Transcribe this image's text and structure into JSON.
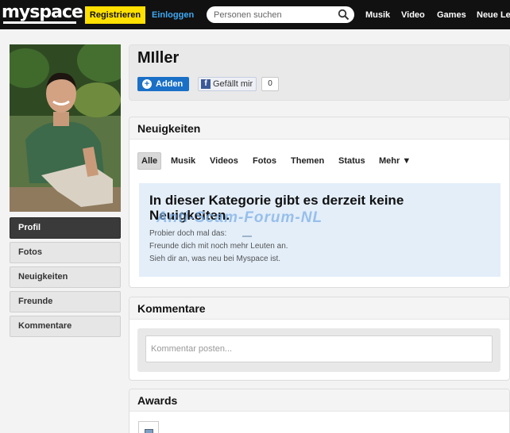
{
  "topbar": {
    "logo": "myspace",
    "register_label": "Registrieren",
    "login_label": "Einloggen",
    "search_placeholder": "Personen suchen",
    "nav": [
      "Musik",
      "Video",
      "Games",
      "Neue Le"
    ]
  },
  "sidebar": {
    "items": [
      {
        "label": "Profil",
        "active": true
      },
      {
        "label": "Fotos"
      },
      {
        "label": "Neuigkeiten"
      },
      {
        "label": "Freunde"
      },
      {
        "label": "Kommentare"
      }
    ]
  },
  "profile": {
    "name": "MIller",
    "add_label": "Adden",
    "like_label": "Gefällt mir",
    "like_count": "0"
  },
  "news": {
    "title": "Neuigkeiten",
    "filters": [
      "Alle",
      "Musik",
      "Videos",
      "Fotos",
      "Themen",
      "Status",
      "Mehr ▼"
    ],
    "empty_title": "In dieser Kategorie gibt es derzeit keine Neuigkeiten.",
    "watermark": "Anti-Scam-Forum-NL",
    "hint_heading": "Probier doch mal das:",
    "hint_1": "Freunde dich mit noch mehr Leuten an.",
    "hint_2": "Sieh dir an, was neu bei Myspace ist."
  },
  "comments": {
    "title": "Kommentare",
    "placeholder": "Kommentar posten..."
  },
  "awards": {
    "title": "Awards"
  },
  "colors": {
    "topbar": "#111111",
    "register": "#ffe000",
    "login_link": "#3ea9f5",
    "add_button": "#1a70c6",
    "empty_box": "#e3eef9"
  }
}
